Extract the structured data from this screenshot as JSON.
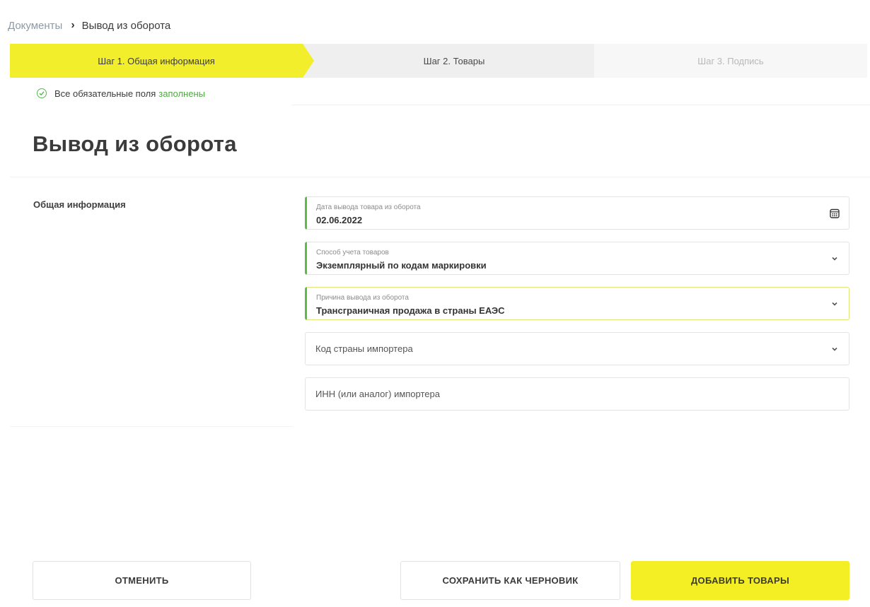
{
  "breadcrumb": {
    "parent": "Документы",
    "current": "Вывод из оборота"
  },
  "steps": [
    {
      "label": "Шаг 1. Общая информация",
      "state": "active"
    },
    {
      "label": "Шаг 2. Товары",
      "state": "pending"
    },
    {
      "label": "Шаг 3. Подпись",
      "state": "disabled"
    }
  ],
  "status": {
    "text": "Все обязательные поля",
    "link": "заполнены"
  },
  "page_title": "Вывод из оборота",
  "section_label": "Общая информация",
  "fields": {
    "date": {
      "label": "Дата вывода товара из оборота",
      "value": "02.06.2022",
      "icon": "calendar-icon"
    },
    "accounting": {
      "label": "Способ учета товаров",
      "value": "Экземплярный по кодам маркировки",
      "icon": "chevron-down-icon"
    },
    "reason": {
      "label": "Причина вывода из оборота",
      "value": "Трансграничная продажа в страны ЕАЭС",
      "icon": "chevron-down-icon"
    },
    "country": {
      "placeholder": "Код страны импортера",
      "icon": "chevron-down-icon"
    },
    "inn": {
      "placeholder": "ИНН (или аналог) импортера"
    }
  },
  "buttons": {
    "cancel": "ОТМЕНИТЬ",
    "save_draft": "СОХРАНИТЬ КАК ЧЕРНОВИК",
    "add_goods": "ДОБАВИТЬ ТОВАРЫ"
  },
  "colors": {
    "accent_yellow": "#f2ee2c",
    "success_green": "#4daa3f"
  }
}
